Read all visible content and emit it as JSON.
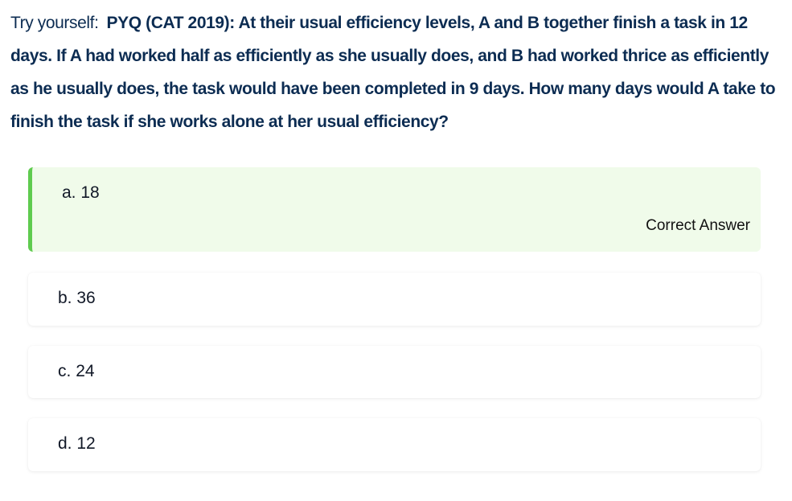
{
  "question": {
    "prefix": "Try yourself:",
    "text": "PYQ (CAT 2019): At their usual efficiency levels, A and B together finish a task in 12 days. If A had worked half as efficiently as she usually does, and B had worked thrice as efficiently as he usually does, the task would have been completed in 9 days. How many days would A take to finish the task if she works alone at her usual efficiency?"
  },
  "options": [
    {
      "letter": "a.",
      "value": "18",
      "correct": true
    },
    {
      "letter": "b.",
      "value": "36",
      "correct": false
    },
    {
      "letter": "c.",
      "value": "24",
      "correct": false
    },
    {
      "letter": "d.",
      "value": "12",
      "correct": false
    }
  ],
  "correct_label": "Correct Answer",
  "colors": {
    "question_text": "#0c2c52",
    "correct_bg": "#f0fbea",
    "correct_border": "#5fcb4f"
  }
}
